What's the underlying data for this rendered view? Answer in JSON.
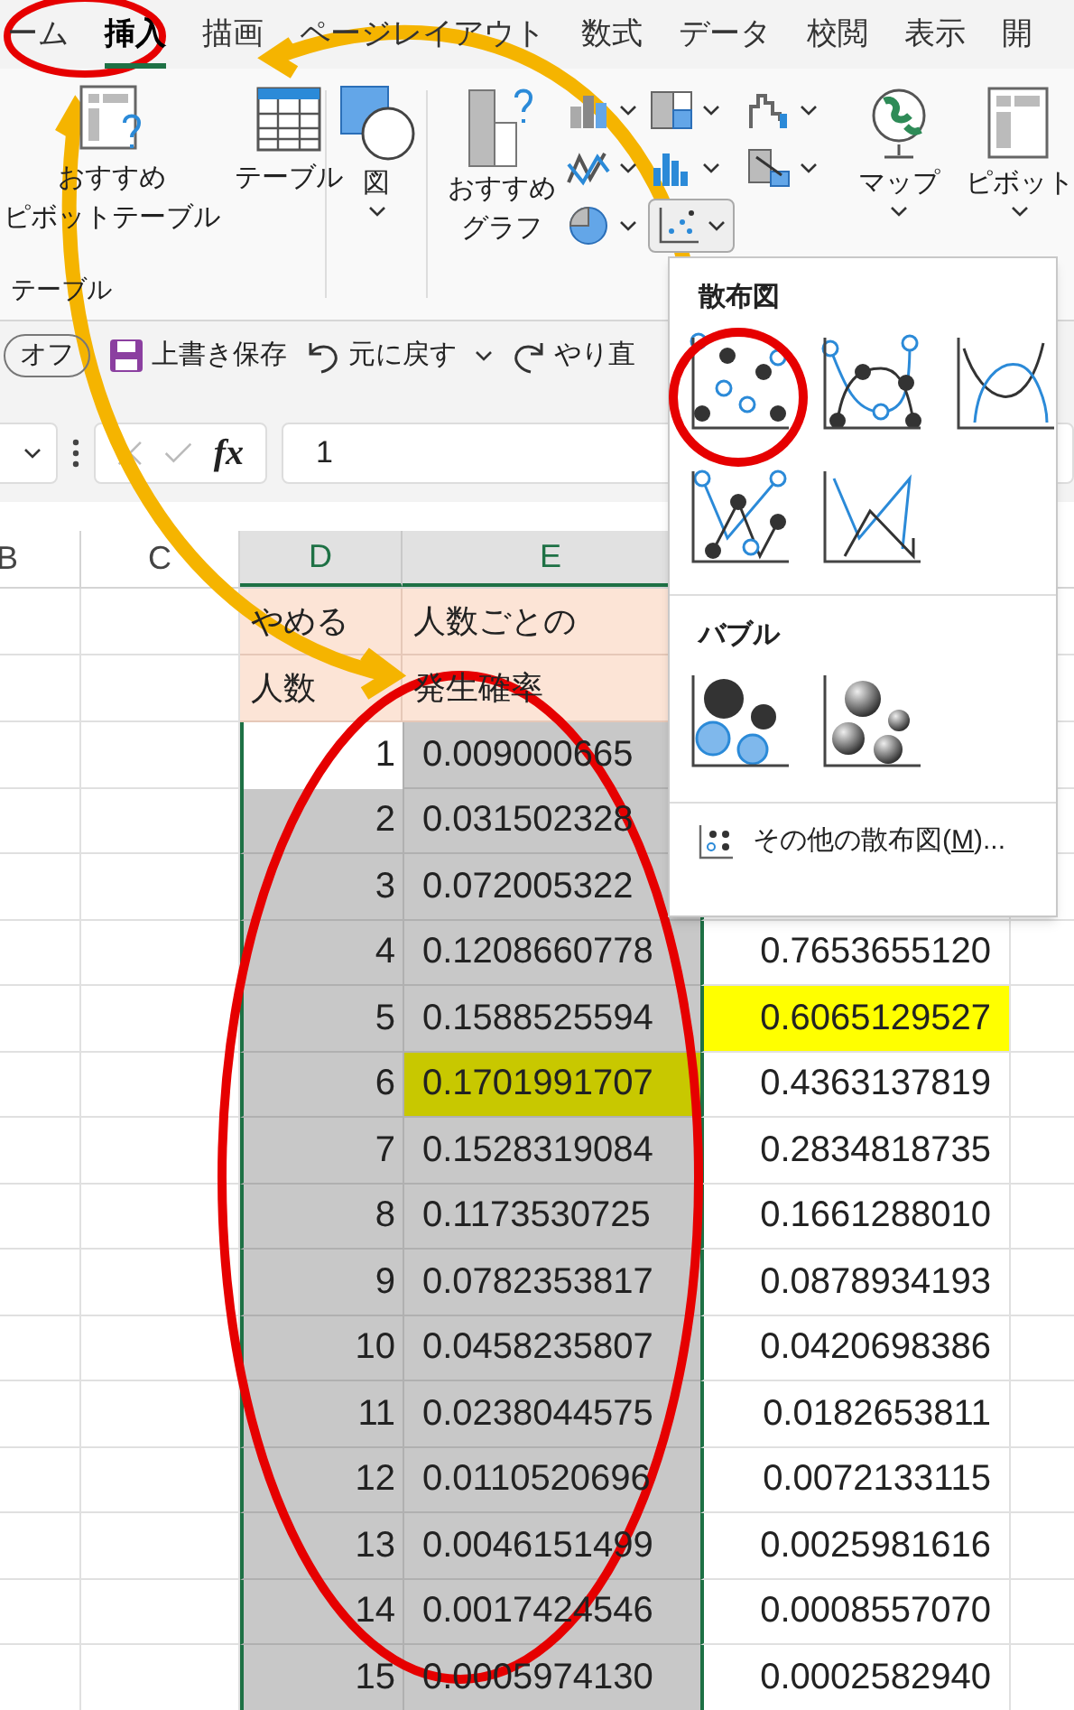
{
  "ribbon_tabs": [
    {
      "label": "ーム",
      "selected": false
    },
    {
      "label": "挿入",
      "selected": true
    },
    {
      "label": "描画",
      "selected": false
    },
    {
      "label": "ページレイアウト",
      "selected": false
    },
    {
      "label": "数式",
      "selected": false
    },
    {
      "label": "データ",
      "selected": false
    },
    {
      "label": "校閲",
      "selected": false
    },
    {
      "label": "表示",
      "selected": false
    },
    {
      "label": "開",
      "selected": false
    }
  ],
  "ribbon": {
    "recommended_pivot": [
      "おすすめ",
      "ピボットテーブル"
    ],
    "table": "テーブル",
    "group_label": "テーブル",
    "illustrations": "図",
    "recommended_charts": [
      "おすすめ",
      "グラフ"
    ],
    "maps": "マップ",
    "pivot_chart": "ピボット"
  },
  "quick_access": {
    "autosave": "オフ",
    "save": "上書き保存",
    "undo": "元に戻す",
    "redo": "やり直"
  },
  "formula_bar": {
    "function_label": "fx",
    "value": "1"
  },
  "columns": [
    {
      "label": "B",
      "selected": false
    },
    {
      "label": "C",
      "selected": false
    },
    {
      "label": "D",
      "selected": true
    },
    {
      "label": "E",
      "selected": true
    }
  ],
  "header_rows": [
    [
      "やめる",
      "人数ごとの"
    ],
    [
      "人数",
      "発生確率"
    ]
  ],
  "rows": [
    {
      "number": "1",
      "active": true,
      "probability": "0.009000665",
      "probability_highlighted": false
    },
    {
      "number": "2",
      "active": false,
      "probability": "0.031502328",
      "probability_highlighted": false
    },
    {
      "number": "3",
      "active": false,
      "probability": "0.072005322",
      "probability_highlighted": false
    },
    {
      "number": "4",
      "active": false,
      "probability": "0.1208660778",
      "probability_highlighted": false,
      "cumulative": "0.7653655120",
      "cumulative_highlighted": false
    },
    {
      "number": "5",
      "active": false,
      "probability": "0.1588525594",
      "probability_highlighted": false,
      "cumulative": "0.6065129527",
      "cumulative_highlighted": true
    },
    {
      "number": "6",
      "active": false,
      "probability": "0.1701991707",
      "probability_highlighted": true,
      "cumulative": "0.4363137819",
      "cumulative_highlighted": false
    },
    {
      "number": "7",
      "active": false,
      "probability": "0.1528319084",
      "probability_highlighted": false,
      "cumulative": "0.2834818735",
      "cumulative_highlighted": false
    },
    {
      "number": "8",
      "active": false,
      "probability": "0.1173530725",
      "probability_highlighted": false,
      "cumulative": "0.1661288010",
      "cumulative_highlighted": false
    },
    {
      "number": "9",
      "active": false,
      "probability": "0.0782353817",
      "probability_highlighted": false,
      "cumulative": "0.0878934193",
      "cumulative_highlighted": false
    },
    {
      "number": "10",
      "active": false,
      "probability": "0.0458235807",
      "probability_highlighted": false,
      "cumulative": "0.0420698386",
      "cumulative_highlighted": false
    },
    {
      "number": "11",
      "active": false,
      "probability": "0.0238044575",
      "probability_highlighted": false,
      "cumulative": "0.0182653811",
      "cumulative_highlighted": false
    },
    {
      "number": "12",
      "active": false,
      "probability": "0.0110520696",
      "probability_highlighted": false,
      "cumulative": "0.0072133115",
      "cumulative_highlighted": false
    },
    {
      "number": "13",
      "active": false,
      "probability": "0.0046151499",
      "probability_highlighted": false,
      "cumulative": "0.0025981616",
      "cumulative_highlighted": false
    },
    {
      "number": "14",
      "active": false,
      "probability": "0.0017424546",
      "probability_highlighted": false,
      "cumulative": "0.0008557070",
      "cumulative_highlighted": false
    },
    {
      "number": "15",
      "active": false,
      "probability": "0.0005974130",
      "probability_highlighted": false,
      "cumulative": "0.0002582940",
      "cumulative_highlighted": false
    }
  ],
  "scatter_menu": {
    "sections": [
      {
        "title": "散布図",
        "items": [
          {
            "kind": "markers"
          },
          {
            "kind": "smooth_markers"
          },
          {
            "kind": "smooth"
          },
          {
            "kind": "straight_markers"
          },
          {
            "kind": "straight"
          }
        ]
      },
      {
        "title": "バブル",
        "items": [
          {
            "kind": "bubble"
          },
          {
            "kind": "bubble_3d"
          }
        ]
      }
    ],
    "more": {
      "label": "その他の散布図(",
      "accelerator": "M",
      "suffix": ")..."
    }
  }
}
